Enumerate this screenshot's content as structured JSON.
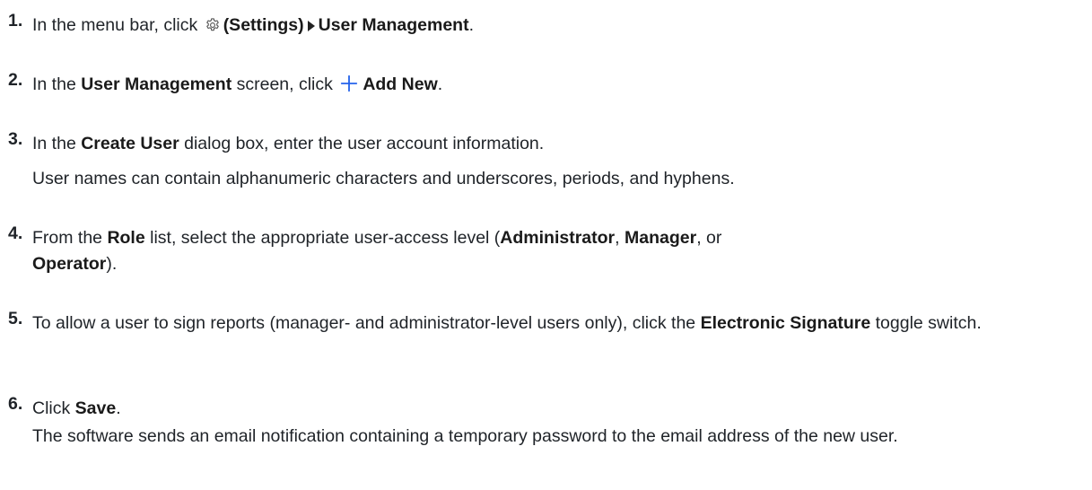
{
  "steps": [
    {
      "number": "1.",
      "pre": "In the menu bar, click ",
      "icon": "gear-icon",
      "settings_label": "(Settings)",
      "separator": "chevron-right-icon",
      "target": "User Management",
      "post": "."
    },
    {
      "number": "2.",
      "pre": "In the ",
      "screen": "User Management",
      "mid": " screen, click ",
      "icon": "plus-icon",
      "button": "Add New",
      "post": "."
    },
    {
      "number": "3.",
      "pre": "In the ",
      "dialog": "Create User",
      "post": " dialog box, enter the user account information.",
      "note": "User names can contain alphanumeric characters and underscores, periods, and hyphens."
    },
    {
      "number": "4.",
      "pre": "From the ",
      "list": "Role",
      "mid": " list, select the appropriate user-access level (",
      "opt1": "Administrator",
      "sep1": ", ",
      "opt2": "Manager",
      "sep2": ", or ",
      "opt3": "Operator",
      "post": ")."
    },
    {
      "number": "5.",
      "pre": "To allow a user to sign reports (manager- and administrator-level users only), click the ",
      "toggle": "Electronic Signature",
      "post": " toggle switch."
    },
    {
      "number": "6.",
      "pre": "Click ",
      "button": "Save",
      "post": ".",
      "note": "The software sends an email notification containing a temporary password to the email address of the new user."
    }
  ],
  "colors": {
    "text": "#1f2328",
    "accent": "#2563eb"
  }
}
